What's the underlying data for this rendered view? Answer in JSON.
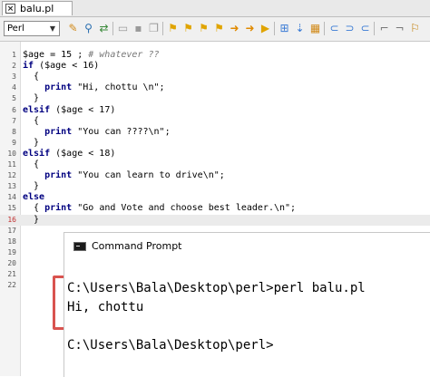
{
  "tab": {
    "filename": "balu.pl",
    "close_glyph": "×"
  },
  "toolbar": {
    "language": "Perl",
    "buttons": [
      {
        "name": "pencil-icon",
        "glyph": "✎",
        "color": "#d18a1a"
      },
      {
        "name": "binoculars-icon",
        "glyph": "⚲",
        "color": "#2a6fb0"
      },
      {
        "name": "search-replace-icon",
        "glyph": "⇄",
        "color": "#3a8a3a"
      },
      {
        "name": "new-file-icon",
        "glyph": "▭",
        "color": "#9a9a9a"
      },
      {
        "name": "save-icon",
        "glyph": "▪",
        "color": "#9a9a9a"
      },
      {
        "name": "copy-icon",
        "glyph": "❐",
        "color": "#9a9a9a"
      },
      {
        "name": "bookmark-icon",
        "glyph": "⚑",
        "color": "#e0a400"
      },
      {
        "name": "bookmark-next-icon",
        "glyph": "⚑",
        "color": "#e0a400"
      },
      {
        "name": "bookmark-prev-icon",
        "glyph": "⚑",
        "color": "#e0a400"
      },
      {
        "name": "bookmark-clear-icon",
        "glyph": "⚑",
        "color": "#e0a400"
      },
      {
        "name": "goto-icon",
        "glyph": "➜",
        "color": "#e08a00"
      },
      {
        "name": "jump-icon",
        "glyph": "➜",
        "color": "#e08a00"
      },
      {
        "name": "run-icon",
        "glyph": "▶",
        "color": "#e0a400"
      },
      {
        "name": "fold-icon",
        "glyph": "⊞",
        "color": "#3a7bd5"
      },
      {
        "name": "expand-icon",
        "glyph": "⇣",
        "color": "#3a7bd5"
      },
      {
        "name": "block-icon",
        "glyph": "▦",
        "color": "#d18a1a"
      },
      {
        "name": "bracket-match-icon",
        "glyph": "⊂",
        "color": "#3a7bd5"
      },
      {
        "name": "indent-icon",
        "glyph": "⊃",
        "color": "#3a7bd5"
      },
      {
        "name": "unindent-icon",
        "glyph": "⊂",
        "color": "#3a7bd5"
      },
      {
        "name": "comment-icon",
        "glyph": "⌐",
        "color": "#777777"
      },
      {
        "name": "uncomment-icon",
        "glyph": "¬",
        "color": "#777777"
      },
      {
        "name": "flag-icon",
        "glyph": "⚐",
        "color": "#c07b00"
      }
    ]
  },
  "editor": {
    "current_line": 16,
    "line_count": 22,
    "lines": [
      {
        "n": "1",
        "text": "$age = 15 ; # whatever ??"
      },
      {
        "n": "2",
        "text": "if ($age < 16)"
      },
      {
        "n": "3",
        "text": "  {"
      },
      {
        "n": "4",
        "text": "    print \"Hi, chottu \\n\";"
      },
      {
        "n": "5",
        "text": "  }"
      },
      {
        "n": "6",
        "text": "elsif ($age < 17)"
      },
      {
        "n": "7",
        "text": "  {"
      },
      {
        "n": "8",
        "text": "    print \"You can ????\\n\";"
      },
      {
        "n": "9",
        "text": "  }"
      },
      {
        "n": "10",
        "text": "elsif ($age < 18)"
      },
      {
        "n": "11",
        "text": "  {"
      },
      {
        "n": "12",
        "text": "    print \"You can learn to drive\\n\";"
      },
      {
        "n": "13",
        "text": "  }"
      },
      {
        "n": "14",
        "text": "else"
      },
      {
        "n": "15",
        "text": "  { print \"Go and Vote and choose best leader.\\n\";"
      },
      {
        "n": "16",
        "text": "  }"
      },
      {
        "n": "17",
        "text": ""
      },
      {
        "n": "18",
        "text": ""
      },
      {
        "n": "19",
        "text": ""
      },
      {
        "n": "20",
        "text": ""
      },
      {
        "n": "21",
        "text": ""
      },
      {
        "n": "22",
        "text": ""
      }
    ]
  },
  "cmd": {
    "title": "Command Prompt",
    "output": [
      "C:\\Users\\Bala\\Desktop\\perl>perl balu.pl",
      "Hi, chottu",
      "",
      "C:\\Users\\Bala\\Desktop\\perl>"
    ]
  },
  "colors": {
    "highlight_box": "#d9534f",
    "keyword": "#000080",
    "comment": "#777777",
    "current_line_number": "#c03030"
  }
}
